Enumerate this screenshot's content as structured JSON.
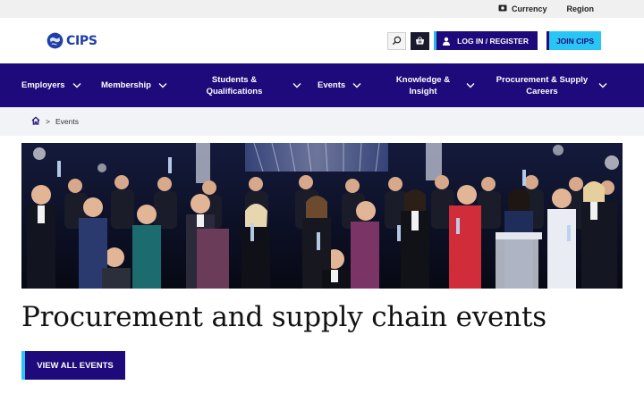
{
  "utility": {
    "currency_label": "Currency",
    "region_label": "Region"
  },
  "header": {
    "logo_text": "CIPS",
    "login_label": "LOG IN / REGISTER",
    "join_label": "JOIN CIPS"
  },
  "nav": {
    "items": [
      {
        "label": "Employers"
      },
      {
        "label": "Membership"
      },
      {
        "label": "Students & Qualifications"
      },
      {
        "label": "Events"
      },
      {
        "label": "Knowledge & Insight"
      },
      {
        "label": "Procurement & Supply Careers"
      }
    ]
  },
  "breadcrumb": {
    "current": "Events",
    "separator": ">"
  },
  "main": {
    "title": "Procurement and supply chain events",
    "cta_label": "VIEW ALL EVENTS"
  },
  "colors": {
    "brand_navy": "#1e0a7a",
    "brand_cyan": "#29c6f5",
    "logo_blue": "#1e3fa8"
  },
  "icons": [
    "cash-icon",
    "search-icon",
    "basket-icon",
    "user-icon",
    "chevron-down-icon",
    "home-icon"
  ]
}
